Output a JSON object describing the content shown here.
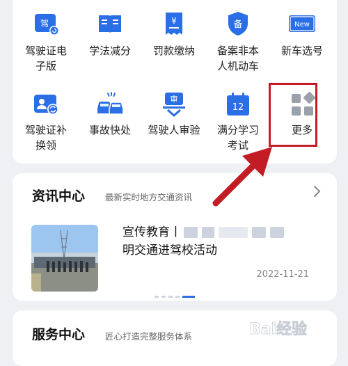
{
  "services": [
    {
      "label": "驾驶证电\n子版",
      "icon": "license-card-icon",
      "badge": "驾"
    },
    {
      "label": "学法减分",
      "icon": "book-icon"
    },
    {
      "label": "罚款缴纳",
      "icon": "fine-receipt-icon",
      "badge": "¥"
    },
    {
      "label": "备案非本\n人机动车",
      "icon": "shield-icon",
      "badge": "备"
    },
    {
      "label": "新车选号",
      "icon": "new-plate-icon",
      "badge": "New"
    },
    {
      "label": "驾驶证补\n换领",
      "icon": "license-renew-icon"
    },
    {
      "label": "事故快处",
      "icon": "car-accident-icon"
    },
    {
      "label": "驾驶人审验",
      "icon": "review-icon",
      "badge": "审"
    },
    {
      "label": "满分学习\n考试",
      "icon": "calendar-exam-icon",
      "badge": "12"
    },
    {
      "label": "更多",
      "icon": "more-grid-icon"
    }
  ],
  "news": {
    "title": "资讯中心",
    "subtitle": "最新实时地方交通资讯",
    "item": {
      "title_prefix": "宣传教育丨",
      "title_line2": "明交通进驾校活动",
      "date": "2022-11-21"
    }
  },
  "service_center": {
    "title": "服务中心",
    "subtitle": "匠心打造完整服务体系"
  },
  "watermark": "Bai经验",
  "colors": {
    "primary": "#2b6fe6",
    "highlight": "#c21d24"
  }
}
